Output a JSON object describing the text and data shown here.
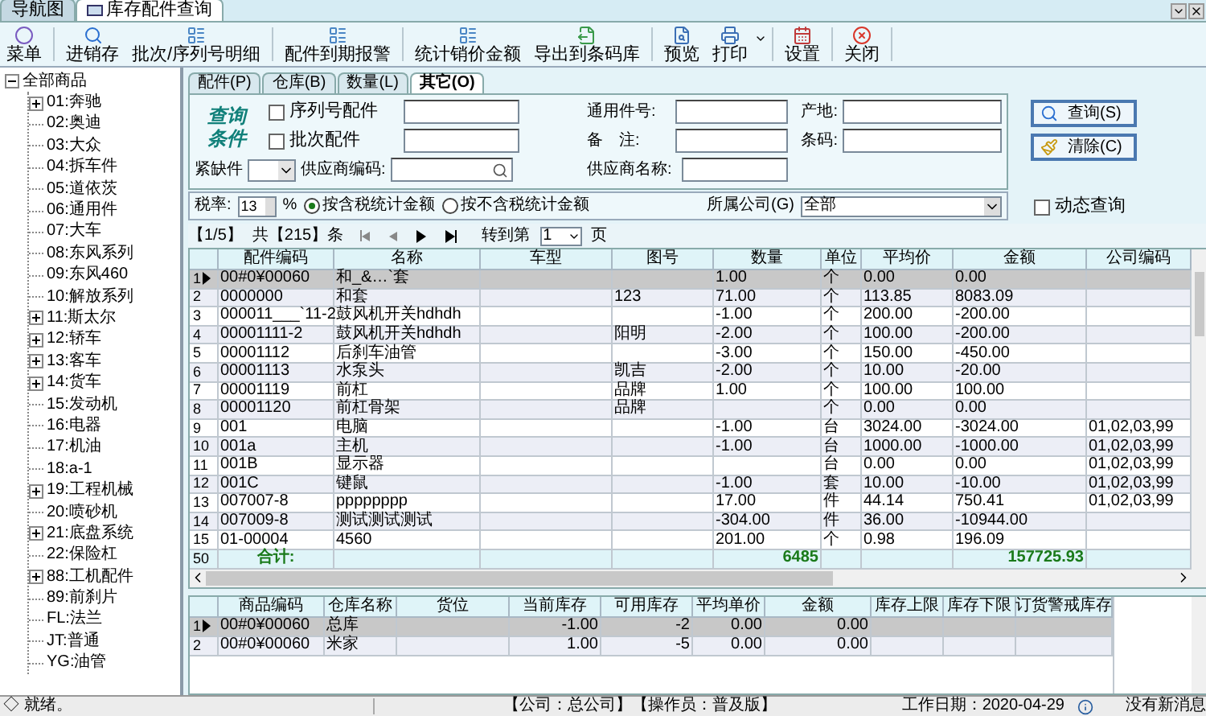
{
  "doc_tabs": [
    {
      "label": "导航图",
      "selected": false
    },
    {
      "label": "库存配件查询",
      "selected": true
    }
  ],
  "toolbar": [
    {
      "label": "菜单",
      "dropdown": false
    },
    {
      "label": "进销存",
      "dropdown": false
    },
    {
      "label": "批次/序列号明细",
      "dropdown": false
    },
    {
      "label": "配件到期报警",
      "dropdown": false
    },
    {
      "label": "统计销价金额",
      "dropdown": false
    },
    {
      "label": "导出到条码库",
      "dropdown": false
    },
    {
      "label": "预览",
      "dropdown": false
    },
    {
      "label": "打印",
      "dropdown": true
    },
    {
      "label": "设置",
      "dropdown": false
    },
    {
      "label": "关闭",
      "dropdown": false
    }
  ],
  "tree": [
    {
      "label": "全部商品",
      "expandable": true,
      "expanded": true,
      "children": [
        {
          "label": "01:奔驰",
          "expandable": true
        },
        {
          "label": "02:奥迪",
          "expandable": false
        },
        {
          "label": "03:大众",
          "expandable": false
        },
        {
          "label": "04:拆车件",
          "expandable": false
        },
        {
          "label": "05:道依茨",
          "expandable": false
        },
        {
          "label": "06:通用件",
          "expandable": false
        },
        {
          "label": "07:大车",
          "expandable": false
        },
        {
          "label": "08:东风系列",
          "expandable": false
        },
        {
          "label": "09:东风460",
          "expandable": false
        },
        {
          "label": "10:解放系列",
          "expandable": false
        },
        {
          "label": "11:斯太尔",
          "expandable": true
        },
        {
          "label": "12:轿车",
          "expandable": true
        },
        {
          "label": "13:客车",
          "expandable": true
        },
        {
          "label": "14:货车",
          "expandable": true
        },
        {
          "label": "15:发动机",
          "expandable": false
        },
        {
          "label": "16:电器",
          "expandable": false
        },
        {
          "label": "17:机油",
          "expandable": false
        },
        {
          "label": "18:a-1",
          "expandable": false
        },
        {
          "label": "19:工程机械",
          "expandable": true
        },
        {
          "label": "20:喷砂机",
          "expandable": false
        },
        {
          "label": "21:底盘系统",
          "expandable": true
        },
        {
          "label": "22:保险杠",
          "expandable": false
        },
        {
          "label": "88:工机配件",
          "expandable": true
        },
        {
          "label": "89:前刹片",
          "expandable": false
        },
        {
          "label": "FL:法兰",
          "expandable": false
        },
        {
          "label": "JT:普通",
          "expandable": false
        },
        {
          "label": "YG:油管",
          "expandable": false
        }
      ]
    }
  ],
  "sub_tabs": [
    {
      "label": "配件(P)",
      "selected": false
    },
    {
      "label": "仓库(B)",
      "selected": false
    },
    {
      "label": "数量(L)",
      "selected": false
    },
    {
      "label": "其它(O)",
      "selected": true
    }
  ],
  "query": {
    "title_lines": [
      "查询",
      "条件"
    ],
    "serial_part": {
      "label": "序列号配件",
      "checked": false
    },
    "batch_part": {
      "label": "批次配件",
      "checked": false
    },
    "general_no_label": "通用件号:",
    "remark_label": "备　注:",
    "origin_label": "产地:",
    "barcode_label": "条码:",
    "shortage_label": "紧缺件",
    "supplier_code_label": "供应商编码:",
    "supplier_name_label": "供应商名称:",
    "buttons": [
      {
        "label": "查询(S)"
      },
      {
        "label": "清除(C)"
      }
    ]
  },
  "tax": {
    "label": "税率:",
    "value": "13",
    "unit": "%",
    "options": [
      {
        "label": "按含税统计金额",
        "selected": true
      },
      {
        "label": "按不含税统计金额",
        "selected": false
      }
    ],
    "company_label": "所属公司(G)",
    "company_value": "全部",
    "dynamic_query": {
      "label": "动态查询",
      "checked": false
    }
  },
  "pager": {
    "page": "【1/5】",
    "total": "共【215】条",
    "goto_label": "转到第",
    "goto_value": "1",
    "page_unit": "页"
  },
  "table": {
    "columns": [
      "配件编码",
      "名称",
      "车型",
      "图号",
      "数量",
      "单位",
      "平均价",
      "金额",
      "公司编码"
    ],
    "rows": [
      {
        "no": "1",
        "selected": true,
        "cells": [
          "00#0¥00060",
          "和_&…`套",
          "",
          "",
          "1.00",
          "个",
          "0.00",
          "0.00",
          ""
        ]
      },
      {
        "no": "2",
        "selected": false,
        "cells": [
          "0000000",
          "和套",
          "",
          "123",
          "71.00",
          "个",
          "113.85",
          "8083.09",
          ""
        ]
      },
      {
        "no": "3",
        "selected": false,
        "cells": [
          "000011___`11-2",
          "鼓风机开关hdhdh",
          "",
          "",
          "-1.00",
          "个",
          "200.00",
          "-200.00",
          ""
        ]
      },
      {
        "no": "4",
        "selected": false,
        "cells": [
          "00001111-2",
          "鼓风机开关hdhdh",
          "",
          "阳明",
          "-2.00",
          "个",
          "100.00",
          "-200.00",
          ""
        ]
      },
      {
        "no": "5",
        "selected": false,
        "cells": [
          "00001112",
          "后刹车油管",
          "",
          "",
          "-3.00",
          "个",
          "150.00",
          "-450.00",
          ""
        ]
      },
      {
        "no": "6",
        "selected": false,
        "cells": [
          "00001113",
          "水泵头",
          "",
          "凯吉",
          "-2.00",
          "个",
          "10.00",
          "-20.00",
          ""
        ]
      },
      {
        "no": "7",
        "selected": false,
        "cells": [
          "00001119",
          "前杠",
          "",
          "品牌",
          "1.00",
          "个",
          "100.00",
          "100.00",
          ""
        ]
      },
      {
        "no": "8",
        "selected": false,
        "cells": [
          "00001120",
          "前杠骨架",
          "",
          "品牌",
          "",
          "个",
          "0.00",
          "0.00",
          ""
        ]
      },
      {
        "no": "9",
        "selected": false,
        "cells": [
          "001",
          "电脑",
          "",
          "",
          "-1.00",
          "台",
          "3024.00",
          "-3024.00",
          "01,02,03,99"
        ]
      },
      {
        "no": "10",
        "selected": false,
        "cells": [
          "001a",
          "主机",
          "",
          "",
          "-1.00",
          "台",
          "1000.00",
          "-1000.00",
          "01,02,03,99"
        ]
      },
      {
        "no": "11",
        "selected": false,
        "cells": [
          "001B",
          "显示器",
          "",
          "",
          "",
          "台",
          "0.00",
          "0.00",
          "01,02,03,99"
        ]
      },
      {
        "no": "12",
        "selected": false,
        "cells": [
          "001C",
          "键鼠",
          "",
          "",
          "-1.00",
          "套",
          "10.00",
          "-10.00",
          "01,02,03,99"
        ]
      },
      {
        "no": "13",
        "selected": false,
        "cells": [
          "007007-8",
          "pppppppp",
          "",
          "",
          "17.00",
          "件",
          "44.14",
          "750.41",
          "01,02,03,99"
        ]
      },
      {
        "no": "14",
        "selected": false,
        "cells": [
          "007009-8",
          "测试测试测试",
          "",
          "",
          "-304.00",
          "件",
          "36.00",
          "-10944.00",
          ""
        ]
      },
      {
        "no": "15",
        "selected": false,
        "cells": [
          "01-00004",
          "4560",
          "",
          "",
          "201.00",
          "个",
          "0.98",
          "196.09",
          ""
        ]
      }
    ],
    "total": {
      "no": "50",
      "cells": [
        "合计:",
        "",
        "",
        "",
        "6485",
        "",
        "",
        "157725.93",
        ""
      ]
    }
  },
  "stock_table": {
    "columns": [
      "商品编码",
      "仓库名称",
      "货位",
      "当前库存",
      "可用库存",
      "平均单价",
      "金额",
      "库存上限",
      "库存下限",
      "订货警戒库存"
    ],
    "rows": [
      {
        "no": "1",
        "selected": true,
        "cells": [
          "00#0¥00060",
          "总库",
          "",
          "-1.00",
          "-2",
          "0.00",
          "0.00",
          "",
          "",
          ""
        ]
      },
      {
        "no": "2",
        "selected": false,
        "cells": [
          "00#0¥00060",
          "米家",
          "",
          "1.00",
          "-5",
          "0.00",
          "0.00",
          "",
          "",
          ""
        ]
      }
    ]
  },
  "status_bar": {
    "state": "◇ 就绪。",
    "company": "【公司：总公司】【操作员：普及版】",
    "work_date": "工作日期：2020-04-29",
    "messages": "没有新消息"
  }
}
